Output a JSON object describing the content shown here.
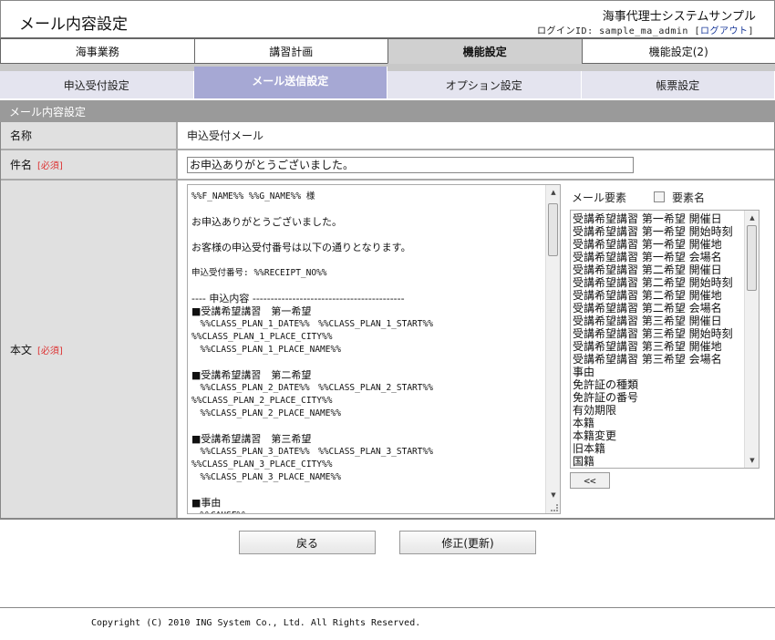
{
  "header": {
    "title": "メール内容設定",
    "system_name": "海事代理士システムサンプル",
    "login_prefix": "ログインID: sample_ma_admin [",
    "logout_label": "ログアウト",
    "login_suffix": "]"
  },
  "main_tabs": [
    {
      "label": "海事業務"
    },
    {
      "label": "講習計画"
    },
    {
      "label": "機能設定"
    },
    {
      "label": "機能設定(2)"
    }
  ],
  "sub_tabs": [
    {
      "label": "申込受付設定"
    },
    {
      "label": "メール送信設定"
    },
    {
      "label": "オプション設定"
    },
    {
      "label": "帳票設定"
    }
  ],
  "section": {
    "title": "メール内容設定"
  },
  "form": {
    "name_label": "名称",
    "name_value": "申込受付メール",
    "subject_label": "件名",
    "required_mark": "[必須]",
    "subject_value": "お申込ありがとうございました。",
    "body_label": "本文"
  },
  "body_text": [
    "%%F_NAME%% %%G_NAME%% 様",
    "",
    "お申込ありがとうございました。",
    "",
    "お客様の申込受付番号は以下の通りとなります。",
    "",
    "申込受付番号: %%RECEIPT_NO%%",
    "",
    "---- 申込内容 ------------------------------------------",
    "■受講希望講習　第一希望",
    "　%%CLASS_PLAN_1_DATE%%　%%CLASS_PLAN_1_START%%",
    "%%CLASS_PLAN_1_PLACE_CITY%%",
    "　%%CLASS_PLAN_1_PLACE_NAME%%",
    "",
    "■受講希望講習　第二希望",
    "　%%CLASS_PLAN_2_DATE%%　%%CLASS_PLAN_2_START%%",
    "%%CLASS_PLAN_2_PLACE_CITY%%",
    "　%%CLASS_PLAN_2_PLACE_NAME%%",
    "",
    "■受講希望講習　第三希望",
    "　%%CLASS_PLAN_3_DATE%%　%%CLASS_PLAN_3_START%%",
    "%%CLASS_PLAN_3_PLACE_CITY%%",
    "　%%CLASS_PLAN_3_PLACE_NAME%%",
    "",
    "■事由",
    "　%%CAUSE%%"
  ],
  "elements_panel": {
    "title": "メール要素",
    "checkbox_label": "要素名",
    "checkbox_checked": false,
    "items": [
      "受講希望講習 第一希望 開催日",
      "受講希望講習 第一希望 開始時刻",
      "受講希望講習 第一希望 開催地",
      "受講希望講習 第一希望 会場名",
      "受講希望講習 第二希望 開催日",
      "受講希望講習 第二希望 開始時刻",
      "受講希望講習 第二希望 開催地",
      "受講希望講習 第二希望 会場名",
      "受講希望講習 第三希望 開催日",
      "受講希望講習 第三希望 開始時刻",
      "受講希望講習 第三希望 開催地",
      "受講希望講習 第三希望 会場名",
      "事由",
      "免許証の種類",
      "免許証の番号",
      "有効期限",
      "本籍",
      "本籍変更",
      "旧本籍",
      "国籍"
    ],
    "insert_button": "<<"
  },
  "actions": {
    "back_label": "戻る",
    "update_label": "修正(更新)"
  },
  "footer": {
    "copyright": "Copyright (C) 2010 ING System Co., Ltd. All Rights Reserved."
  },
  "colors": {
    "active_subtab": "#a6a8d4",
    "required": "#dd3333",
    "section_header": "#9a9a9a",
    "logout_link": "#1a3a9a"
  }
}
